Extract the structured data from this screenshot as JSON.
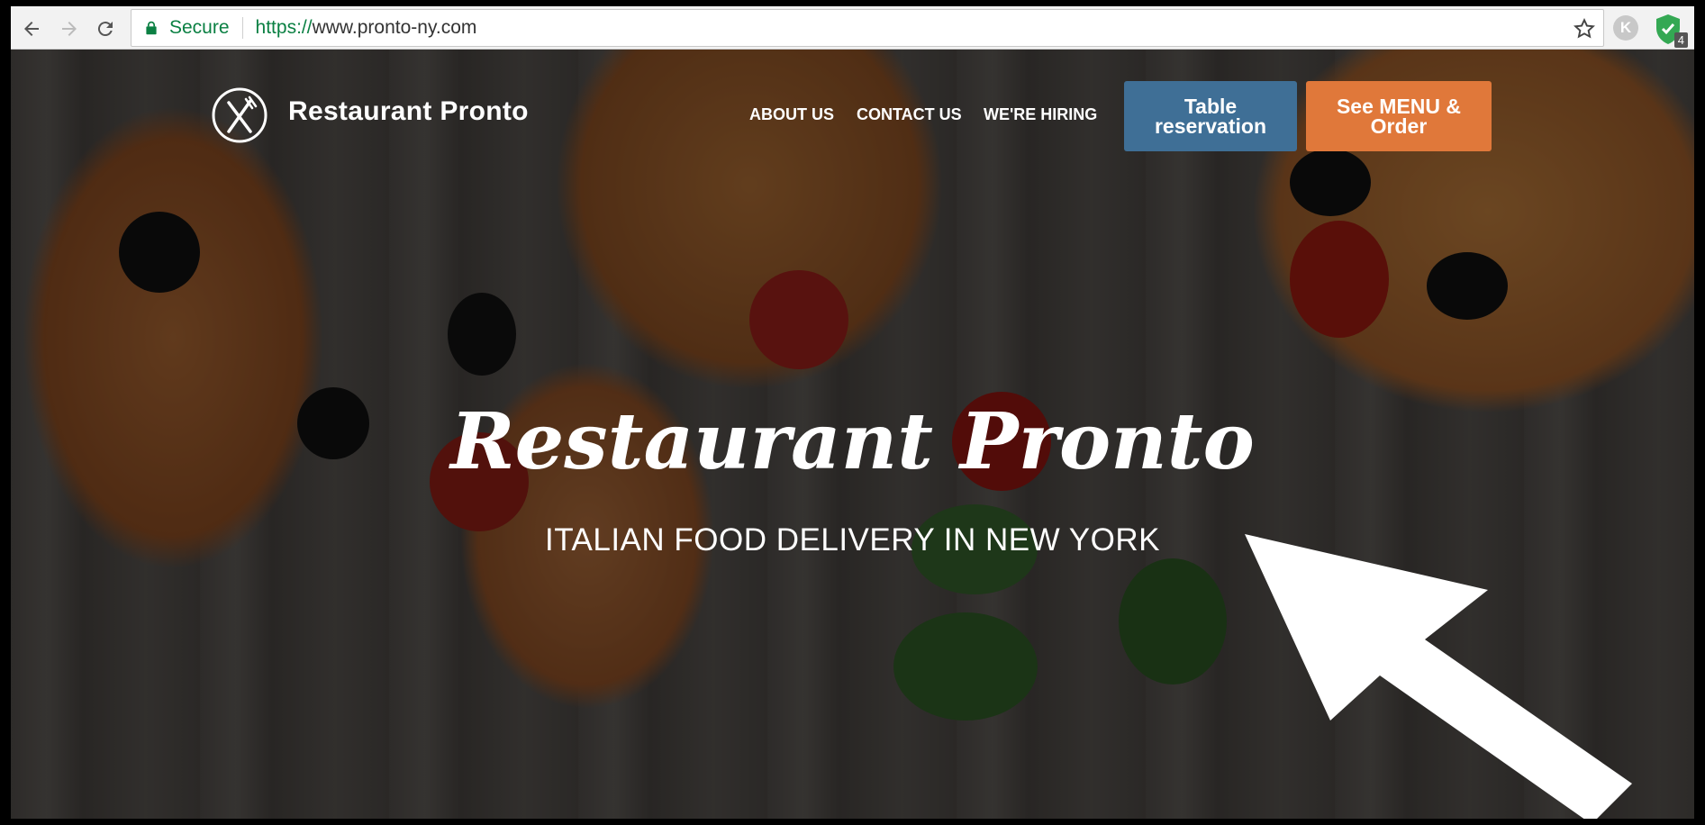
{
  "browser": {
    "secure_label": "Secure",
    "url_scheme": "https://",
    "url_rest": "www.pronto-ny.com",
    "extension_k_label": "K",
    "extension_badge_count": "4"
  },
  "site": {
    "brand": "Restaurant Pronto",
    "nav": [
      {
        "label": "ABOUT US"
      },
      {
        "label": "CONTACT US"
      },
      {
        "label": "WE'RE HIRING"
      }
    ],
    "cta_table": "Table reservation",
    "cta_menu": "See MENU & Order",
    "hero_title": "Restaurant Pronto",
    "hero_subtitle": "ITALIAN FOOD DELIVERY IN NEW YORK"
  },
  "colors": {
    "table_button": "#3f6f96",
    "menu_button": "#e0783a",
    "secure_green": "#0b8043"
  }
}
